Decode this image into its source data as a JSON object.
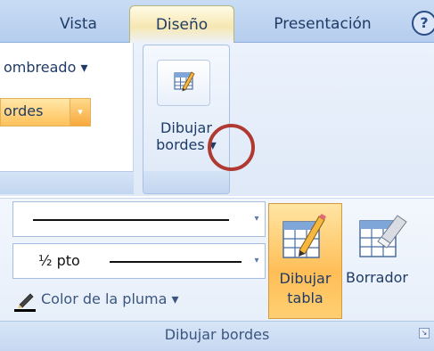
{
  "tabs": [
    {
      "label": "Vista"
    },
    {
      "label": "Diseño"
    },
    {
      "label": "Presentación"
    }
  ],
  "help_label": "?",
  "ribbon_upper": {
    "sombreado_label": "ombreado ▾",
    "bordes_label": "ordes",
    "bordes_arrow": "▾",
    "dibujar_bordes_line1": "Dibujar",
    "dibujar_bordes_line2": "bordes ▾"
  },
  "dibujar_bordes_group": {
    "line_weight": "½ pto",
    "pen_color_label": "Color de la pluma ▾",
    "draw_table_line1": "Dibujar",
    "draw_table_line2": "tabla",
    "eraser_label": "Borrador",
    "group_label": "Dibujar bordes",
    "combo_arrow": "▾",
    "launcher_glyph": "↘"
  }
}
